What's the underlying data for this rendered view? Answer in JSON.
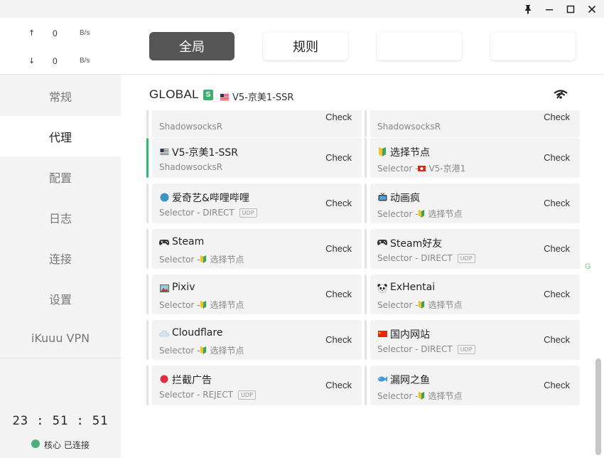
{
  "window": {
    "controls": [
      "pin-icon",
      "minimize-icon",
      "maximize-icon",
      "close-icon"
    ]
  },
  "traffic": {
    "up_arrow": "↑",
    "up_value": "0",
    "up_unit": "B/s",
    "down_arrow": "↓",
    "down_value": "0",
    "down_unit": "B/s"
  },
  "sidebar": {
    "items": [
      {
        "label": "常规"
      },
      {
        "label": "代理"
      },
      {
        "label": "配置"
      },
      {
        "label": "日志"
      },
      {
        "label": "连接"
      },
      {
        "label": "设置"
      },
      {
        "label": "iKuuu VPN"
      }
    ],
    "active": "代理",
    "clock": "23 : 51 : 51",
    "status": "核心 已连接",
    "status_color": "#4caf7d"
  },
  "modes": [
    {
      "label": "全局",
      "active": true
    },
    {
      "label": "规则",
      "active": false
    },
    {
      "label": "",
      "active": false
    },
    {
      "label": "",
      "active": false
    }
  ],
  "group": {
    "name": "GLOBAL",
    "badge": "S",
    "current": "V5-京美1-SSR",
    "current_flag": "us-flag-icon"
  },
  "cards": [
    {
      "name": "",
      "sub": "ShadowsocksR",
      "check": "Check"
    },
    {
      "name": "",
      "sub": "ShadowsocksR",
      "check": "Check"
    },
    {
      "name": "V5-京美1-SSR",
      "icon": "us-flag-icon",
      "sub": "ShadowsocksR",
      "check": "Check",
      "selected": true
    },
    {
      "name": "选择节点",
      "icon": "beginner-icon",
      "sub_pre": "Selector - ",
      "sub_icon": "hk-flag-icon",
      "sub_post": "V5-京港1",
      "check": "Check"
    },
    {
      "name": "爱奇艺&哔哩哔哩",
      "icon": "globe-icon",
      "sub_pre": "Selector - DIRECT",
      "udp": "UDP",
      "check": "Check"
    },
    {
      "name": "动画疯",
      "icon": "tv-icon",
      "sub_pre": "Selector - ",
      "sub_icon": "beginner-icon",
      "sub_post": "选择节点",
      "check": "Check"
    },
    {
      "name": "Steam",
      "icon": "gamepad-icon",
      "sub_pre": "Selector - ",
      "sub_icon": "beginner-icon",
      "sub_post": "选择节点",
      "check": "Check"
    },
    {
      "name": "Steam好友",
      "icon": "gamepad-icon",
      "sub_pre": "Selector - DIRECT",
      "udp": "UDP",
      "check": "Check"
    },
    {
      "name": "Pixiv",
      "icon": "picture-icon",
      "sub_pre": "Selector - ",
      "sub_icon": "beginner-icon",
      "sub_post": "选择节点",
      "check": "Check"
    },
    {
      "name": "ExHentai",
      "icon": "panda-icon",
      "sub_pre": "Selector - ",
      "sub_icon": "beginner-icon",
      "sub_post": "选择节点",
      "check": "Check"
    },
    {
      "name": "Cloudflare",
      "icon": "cloud-icon",
      "sub_pre": "Selector - ",
      "sub_icon": "beginner-icon",
      "sub_post": "选择节点",
      "check": "Check"
    },
    {
      "name": "国内网站",
      "icon": "cn-flag-icon",
      "sub_pre": "Selector - DIRECT",
      "udp": "UDP",
      "check": "Check"
    },
    {
      "name": "拦截广告",
      "icon": "red-circle-icon",
      "sub_pre": "Selector - REJECT",
      "udp": "UDP",
      "check": "Check"
    },
    {
      "name": "漏网之鱼",
      "icon": "fish-icon",
      "sub_pre": "Selector - ",
      "sub_icon": "beginner-icon",
      "sub_post": "选择节点",
      "check": "Check"
    }
  ],
  "side_letter": "G"
}
